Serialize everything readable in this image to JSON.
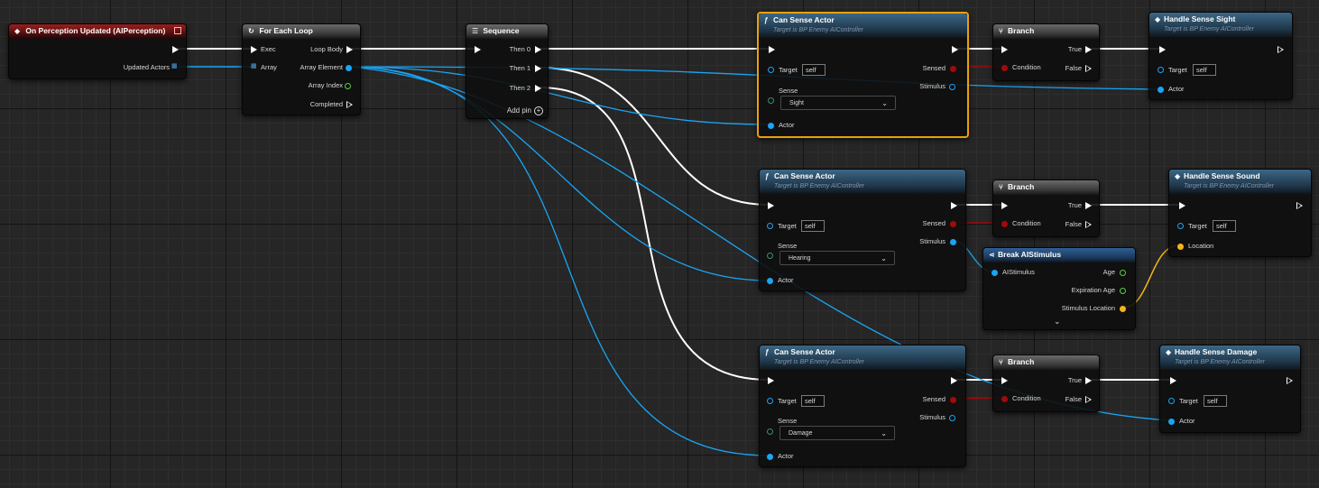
{
  "colors": {
    "exec_wire": "#ffffff",
    "object_wire": "#19a5f5",
    "vector_wire": "#f5b51a",
    "selection": "#e8a10d"
  },
  "nodes": {
    "event": {
      "title": "On Perception Updated (AIPerception)",
      "updated_actors": "Updated Actors"
    },
    "foreach": {
      "title": "For Each Loop",
      "exec": "Exec",
      "array": "Array",
      "loop_body": "Loop Body",
      "array_element": "Array Element",
      "array_index": "Array Index",
      "completed": "Completed"
    },
    "sequence": {
      "title": "Sequence",
      "then0": "Then 0",
      "then1": "Then 1",
      "then2": "Then 2",
      "add_pin": "Add pin"
    },
    "can_sense_1": {
      "title": "Can Sense Actor",
      "subtitle": "Target is BP Enemy AIController",
      "target": "Target",
      "self": "self",
      "sense": "Sense",
      "sense_value": "Sight",
      "actor": "Actor",
      "sensed": "Sensed",
      "stimulus": "Stimulus"
    },
    "can_sense_2": {
      "title": "Can Sense Actor",
      "subtitle": "Target is BP Enemy AIController",
      "target": "Target",
      "self": "self",
      "sense": "Sense",
      "sense_value": "Hearing",
      "actor": "Actor",
      "sensed": "Sensed",
      "stimulus": "Stimulus"
    },
    "can_sense_3": {
      "title": "Can Sense Actor",
      "subtitle": "Target is BP Enemy AIController",
      "target": "Target",
      "self": "self",
      "sense": "Sense",
      "sense_value": "Damage",
      "actor": "Actor",
      "sensed": "Sensed",
      "stimulus": "Stimulus"
    },
    "branch_1": {
      "title": "Branch",
      "condition": "Condition",
      "true": "True",
      "false": "False"
    },
    "branch_2": {
      "title": "Branch",
      "condition": "Condition",
      "true": "True",
      "false": "False"
    },
    "branch_3": {
      "title": "Branch",
      "condition": "Condition",
      "true": "True",
      "false": "False"
    },
    "handle_sight": {
      "title": "Handle Sense Sight",
      "subtitle": "Target is BP Enemy AIController",
      "target": "Target",
      "self": "self",
      "actor": "Actor"
    },
    "handle_sound": {
      "title": "Handle Sense Sound",
      "subtitle": "Target is BP Enemy AIController",
      "target": "Target",
      "self": "self",
      "location": "Location"
    },
    "handle_damage": {
      "title": "Handle Sense Damage",
      "subtitle": "Target is BP Enemy AIController",
      "target": "Target",
      "self": "self",
      "actor": "Actor"
    },
    "break_stimulus": {
      "title": "Break AIStimulus",
      "ai_stimulus": "AIStimulus",
      "age": "Age",
      "expiration_age": "Expiration Age",
      "stimulus_location": "Stimulus Location"
    }
  }
}
